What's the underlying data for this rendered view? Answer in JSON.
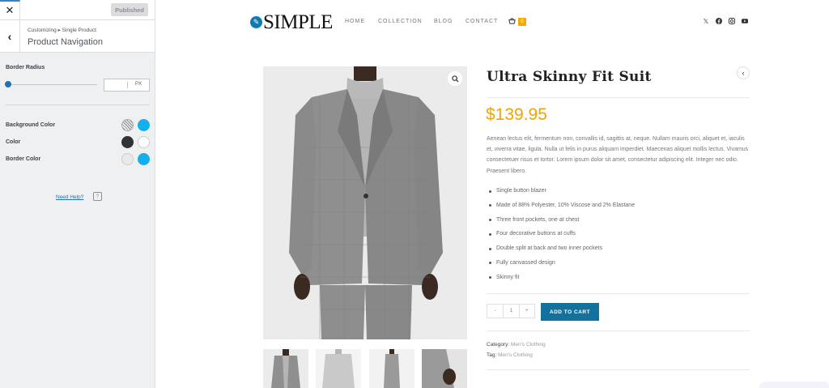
{
  "customizer": {
    "close_icon": "close-icon",
    "published_label": "Published",
    "breadcrumb": "Customizing ▸ Single Product",
    "section_title": "Product Navigation",
    "border_radius_label": "Border Radius",
    "border_radius_value": "",
    "border_radius_slider": 0,
    "border_radius_unit": "PX",
    "background_color_label": "Background Color",
    "color_label": "Color",
    "border_color_label": "Border Color",
    "colors": {
      "background_normal": "transparent",
      "background_hover": "#13aff0",
      "color_normal": "#333333",
      "color_hover": "#ffffff",
      "border_normal": "#e9e9e9",
      "border_hover": "#13aff0"
    },
    "help_link": "Need Help?"
  },
  "site": {
    "logo_text": "SIMPLE",
    "nav": [
      "HOME",
      "COLLECTION",
      "BLOG",
      "CONTACT"
    ],
    "cart_count": "0",
    "social_icons": [
      "x-icon",
      "facebook-icon",
      "instagram-icon",
      "youtube-icon"
    ],
    "accent_color": "#13719e",
    "price_color": "#f0a400"
  },
  "product": {
    "title": "Ultra Skinny Fit Suit",
    "price": "$139.95",
    "description": "Aenean lectus elit, fermentum non, convallis id, sagittis at, neque. Nullam mauris orci, aliquet et, iaculis et, viverra vitae, ligula. Nulla ut felis in purus aliquam imperdiet. Maecenas aliquet mollis lectus. Vivamus consectetuer risus et tortor. Lorem ipsum dolor sit amet, consectetur adipiscing elit. Integer nec odio. Praesent libero.",
    "features": [
      "Single button blazer",
      "Made of 88% Polyester, 10% Viscose and 2% Elastane",
      "Three front pockets, one at chest",
      "Four decorative buttons at cuffs",
      "Double split at back and two inner pockets",
      "Fully canvassed design",
      "Skinny fit"
    ],
    "qty_minus": "-",
    "qty_value": "1",
    "qty_plus": "+",
    "add_to_cart": "ADD TO CART",
    "category_label": "Category:",
    "category_value": "Men's Clothing",
    "tag_label": "Tag:",
    "tag_value": "Men's Clothing"
  }
}
